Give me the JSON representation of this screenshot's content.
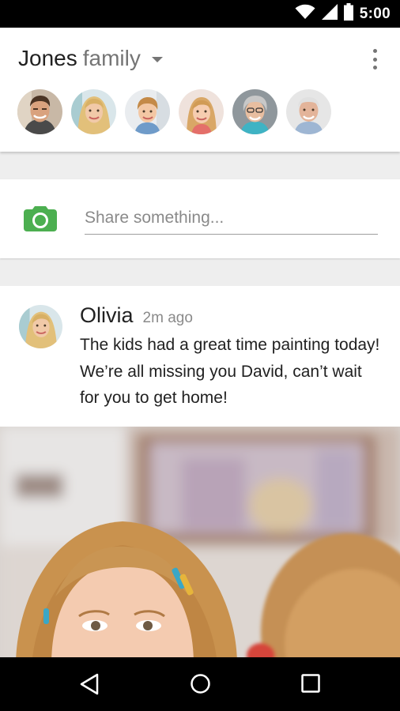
{
  "status_bar": {
    "time": "5:00",
    "icons": [
      "wifi-icon",
      "cell-signal-icon",
      "battery-icon"
    ],
    "background": "#000000"
  },
  "header": {
    "group_name": "Jones",
    "group_suffix": "family",
    "members": [
      {
        "icon": "avatar-man"
      },
      {
        "icon": "avatar-woman"
      },
      {
        "icon": "avatar-boy"
      },
      {
        "icon": "avatar-girl"
      },
      {
        "icon": "avatar-grandmother"
      },
      {
        "icon": "avatar-grandfather"
      }
    ]
  },
  "share": {
    "placeholder": "Share something...",
    "value": "",
    "camera_color": "#4caf50"
  },
  "post": {
    "author": "Olivia",
    "time": "2m ago",
    "text": "The kids had a great time painting today! We’re all missing you David, can’t wait for you to get home!"
  },
  "nav_bar": {
    "buttons": [
      "back-icon",
      "home-icon",
      "recents-icon"
    ]
  }
}
